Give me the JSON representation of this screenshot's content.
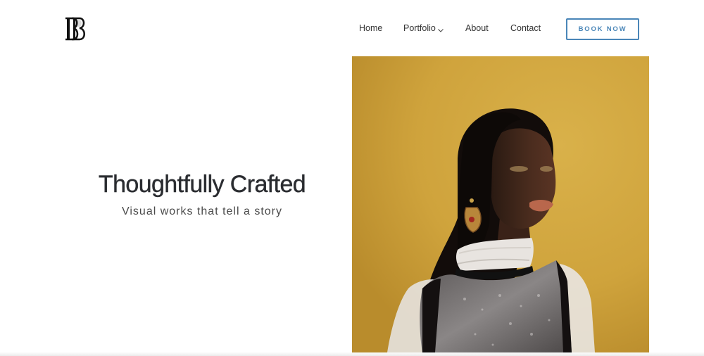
{
  "header": {
    "logo_icon": "bb-monogram-logo",
    "nav": [
      {
        "label": "Home"
      },
      {
        "label": "Portfolio",
        "has_dropdown": true
      },
      {
        "label": "About"
      },
      {
        "label": "Contact"
      }
    ],
    "cta_label": "BOOK NOW"
  },
  "hero": {
    "title": "Thoughtfully Crafted",
    "subtitle": "Visual works that tell a story",
    "image_icon": "portrait-photo"
  },
  "colors": {
    "accent": "#4a86b8",
    "text_dark": "#2a2c30",
    "photo_background": "#d2a740"
  }
}
